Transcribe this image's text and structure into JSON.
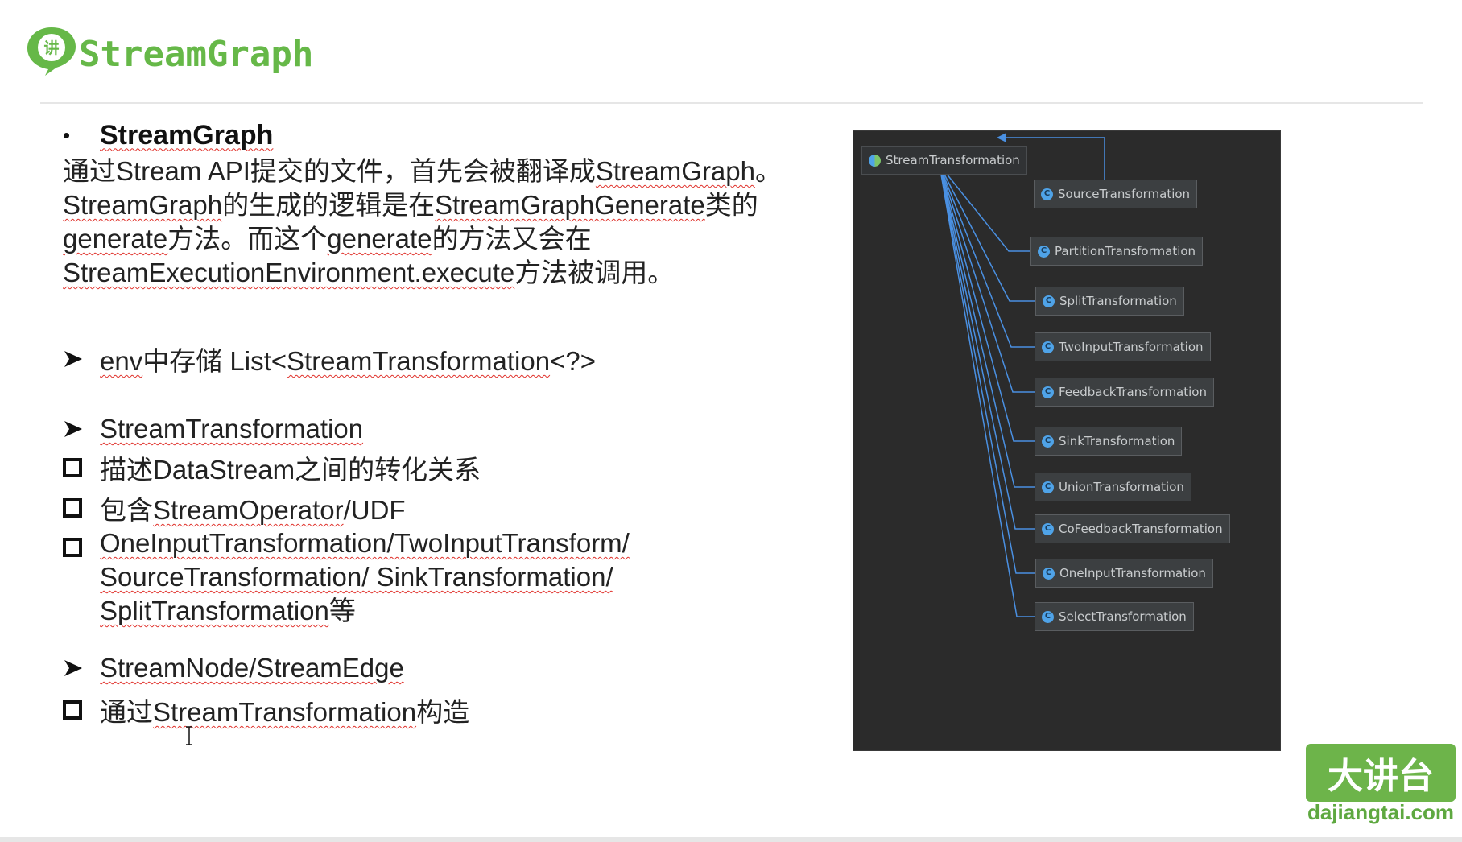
{
  "header": {
    "title": "StreamGraph",
    "logo_glyph": "讲",
    "accent_color": "#66b848"
  },
  "content": {
    "heading": "StreamGraph",
    "paragraph": [
      {
        "parts": [
          {
            "t": "通过Stream API提交的文件，首先会被翻译成",
            "s": false
          },
          {
            "t": "StreamGraph",
            "s": true
          },
          {
            "t": "。",
            "s": false
          }
        ]
      },
      {
        "parts": [
          {
            "t": "StreamGraph",
            "s": true
          },
          {
            "t": "的生成的逻辑是在",
            "s": false
          },
          {
            "t": "StreamGraphGenerate",
            "s": true
          },
          {
            "t": "类的",
            "s": false
          }
        ]
      },
      {
        "parts": [
          {
            "t": "generate",
            "s": true
          },
          {
            "t": "方法。而这个",
            "s": false
          },
          {
            "t": "generate",
            "s": true
          },
          {
            "t": "的方法又会在",
            "s": false
          }
        ]
      },
      {
        "parts": [
          {
            "t": "StreamExecutionEnvironment.execute",
            "s": true
          },
          {
            "t": "方法被调用。",
            "s": false
          }
        ]
      }
    ],
    "env_line": {
      "parts": [
        {
          "t": "env",
          "s": true
        },
        {
          "t": "中存储 List<",
          "s": false
        },
        {
          "t": "StreamTransformation",
          "s": true
        },
        {
          "t": "<?>",
          "s": false
        }
      ]
    },
    "transformation_heading": "StreamTransformation",
    "items": [
      {
        "parts": [
          {
            "t": "描述DataStream之间的转化关系",
            "s": false
          }
        ]
      },
      {
        "parts": [
          {
            "t": "包含",
            "s": false
          },
          {
            "t": "StreamOperator",
            "s": true
          },
          {
            "t": "/UDF",
            "s": false
          }
        ]
      }
    ],
    "multi_item": [
      {
        "parts": [
          {
            "t": "OneInputTransformation/TwoInputTransform/",
            "s": true
          }
        ]
      },
      {
        "parts": [
          {
            "t": "SourceTransformation/ SinkTransformation/",
            "s": true
          }
        ]
      },
      {
        "parts": [
          {
            "t": "SplitTransformation",
            "s": true
          },
          {
            "t": "等",
            "s": false
          }
        ]
      }
    ],
    "node_heading": "StreamNode/StreamEdge",
    "last_item": {
      "parts": [
        {
          "t": "通过",
          "s": false
        },
        {
          "t": "StreamTransformation",
          "s": true
        },
        {
          "t": "构造",
          "s": false
        }
      ]
    }
  },
  "diagram": {
    "root": "StreamTransformation",
    "subclasses": [
      "SourceTransformation",
      "PartitionTransformation",
      "SplitTransformation",
      "TwoInputTransformation",
      "FeedbackTransformation",
      "SinkTransformation",
      "UnionTransformation",
      "CoFeedbackTransformation",
      "OneInputTransformation",
      "SelectTransformation"
    ],
    "class_icon_letter": "C",
    "line_color": "#4a90e2"
  },
  "watermark": {
    "badge": "大讲台",
    "url": "dajiangtai.com"
  }
}
